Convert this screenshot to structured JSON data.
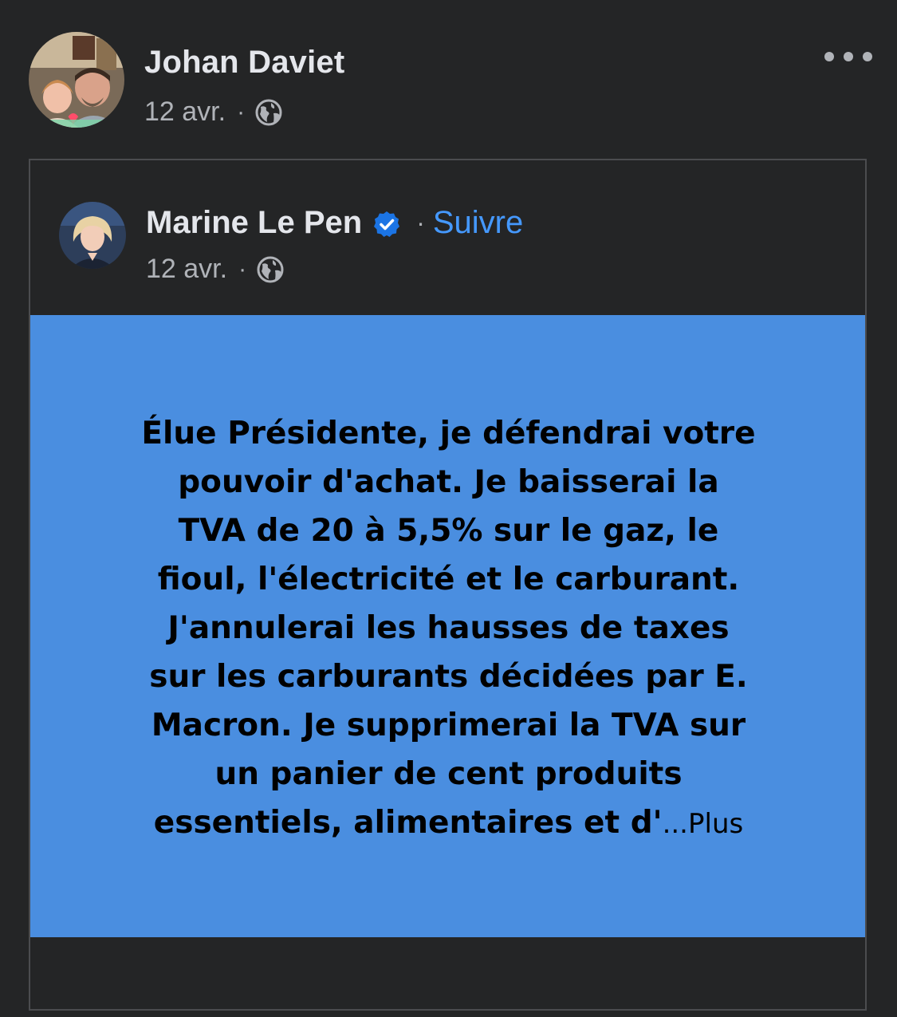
{
  "post": {
    "author": {
      "name": "Johan Daviet",
      "date": "12 avr.",
      "separator": "·",
      "privacy_icon": "globe-icon"
    },
    "menu_icon": "more-options-icon",
    "shared": {
      "author": {
        "name": "Marine Le Pen",
        "verified_icon": "verified-badge-icon",
        "separator": "·",
        "follow_label": "Suivre",
        "date": "12 avr.",
        "privacy_icon": "globe-icon"
      },
      "card": {
        "background_color": "#4a8ee0",
        "lines": [
          "Élue Présidente, je défendrai votre",
          "pouvoir d'achat. Je baisserai la",
          "TVA de 20 à 5,5% sur le gaz, le",
          "fioul, l'électricité et le carburant.",
          "J'annulerai les hausses de taxes",
          "sur les carburants décidées par E.",
          "Macron. Je supprimerai la TVA sur",
          "un panier de cent produits",
          "essentiels, alimentaires et d'"
        ],
        "ellipsis": "...",
        "more_label": "Plus"
      }
    }
  },
  "colors": {
    "background": "#242526",
    "text_primary": "#e4e6eb",
    "text_secondary": "#b0b3b8",
    "link": "#4599ff",
    "border": "#4b4c4f"
  }
}
